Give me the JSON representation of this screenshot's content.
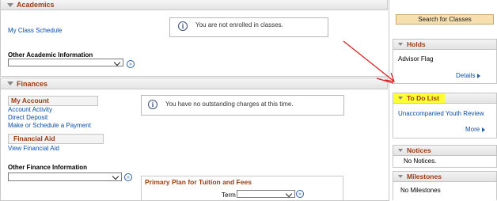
{
  "academics": {
    "header": "Academics",
    "my_class_schedule": "My Class Schedule",
    "not_enrolled_msg": "You are not enrolled in classes.",
    "other_info_label": "Other Academic Information"
  },
  "finances": {
    "header": "Finances",
    "my_account": "My Account",
    "account_activity": "Account Activity",
    "direct_deposit": "Direct Deposit",
    "make_payment": "Make or Schedule a Payment",
    "no_charges_msg": "You have no outstanding charges at this time.",
    "financial_aid": "Financial Aid",
    "view_financial_aid": "View Financial Aid",
    "other_finance_label": "Other Finance Information",
    "primary_plan": "Primary Plan for Tuition and Fees",
    "term_label": "Term"
  },
  "sidebar": {
    "search_classes": "Search for Classes",
    "holds": {
      "header": "Holds",
      "item": "Advisor Flag",
      "details": "Details"
    },
    "todo": {
      "header": "To Do List",
      "item": "Unaccompanied Youth Review",
      "more": "More"
    },
    "notices": {
      "header": "Notices",
      "text": "No Notices."
    },
    "milestones": {
      "header": "Milestones",
      "text": "No Milestones"
    }
  },
  "icons": {
    "go": "go-arrow-icon",
    "info": "info-icon",
    "collapse": "collapse-triangle-icon"
  },
  "colors": {
    "accent": "#9c3b12",
    "link": "#0b4fa8",
    "highlight": "#ffff33",
    "annotation_arrow": "#e01b1b"
  }
}
